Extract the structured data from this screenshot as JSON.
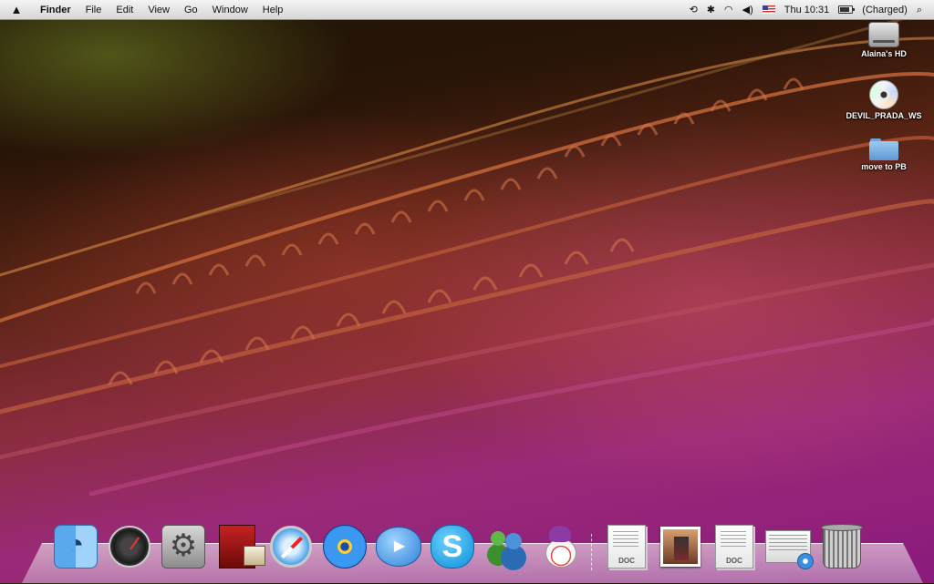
{
  "menubar": {
    "apple": "",
    "app": "Finder",
    "menus": [
      "File",
      "Edit",
      "View",
      "Go",
      "Window",
      "Help"
    ],
    "status": {
      "time_machine": "⟲",
      "bluetooth": "✱",
      "wifi": "◠",
      "volume": "◀)",
      "clock": "Thu 10:31",
      "battery_status": "(Charged)",
      "spotlight": "⌕"
    }
  },
  "desktop_icons": [
    {
      "label": "Alaina's HD",
      "icon": "hard-drive-icon"
    },
    {
      "label": "DEVIL_PRADA_WS",
      "icon": "dvd-icon"
    },
    {
      "label": "move to PB",
      "icon": "folder-icon"
    }
  ],
  "dock": {
    "apps": [
      {
        "name": "finder",
        "icon": "finder-icon"
      },
      {
        "name": "dashboard",
        "icon": "dashboard-icon"
      },
      {
        "name": "system-preferences",
        "icon": "system-preferences-icon"
      },
      {
        "name": "front-row",
        "icon": "front-row-icon"
      },
      {
        "name": "safari",
        "icon": "safari-icon"
      },
      {
        "name": "itunes",
        "icon": "itunes-icon"
      },
      {
        "name": "ichat",
        "icon": "ichat-icon"
      },
      {
        "name": "skype",
        "icon": "skype-icon"
      },
      {
        "name": "messenger",
        "icon": "messenger-icon"
      },
      {
        "name": "adium",
        "icon": "adium-icon"
      }
    ],
    "docs": [
      {
        "tag": "DOC",
        "icon": "document-icon"
      },
      {
        "tag": "",
        "icon": "photo-icon"
      },
      {
        "tag": "DOC",
        "icon": "document-icon"
      },
      {
        "tag": "",
        "icon": "window-preview-icon"
      },
      {
        "tag": "",
        "icon": "trash-icon"
      }
    ]
  }
}
